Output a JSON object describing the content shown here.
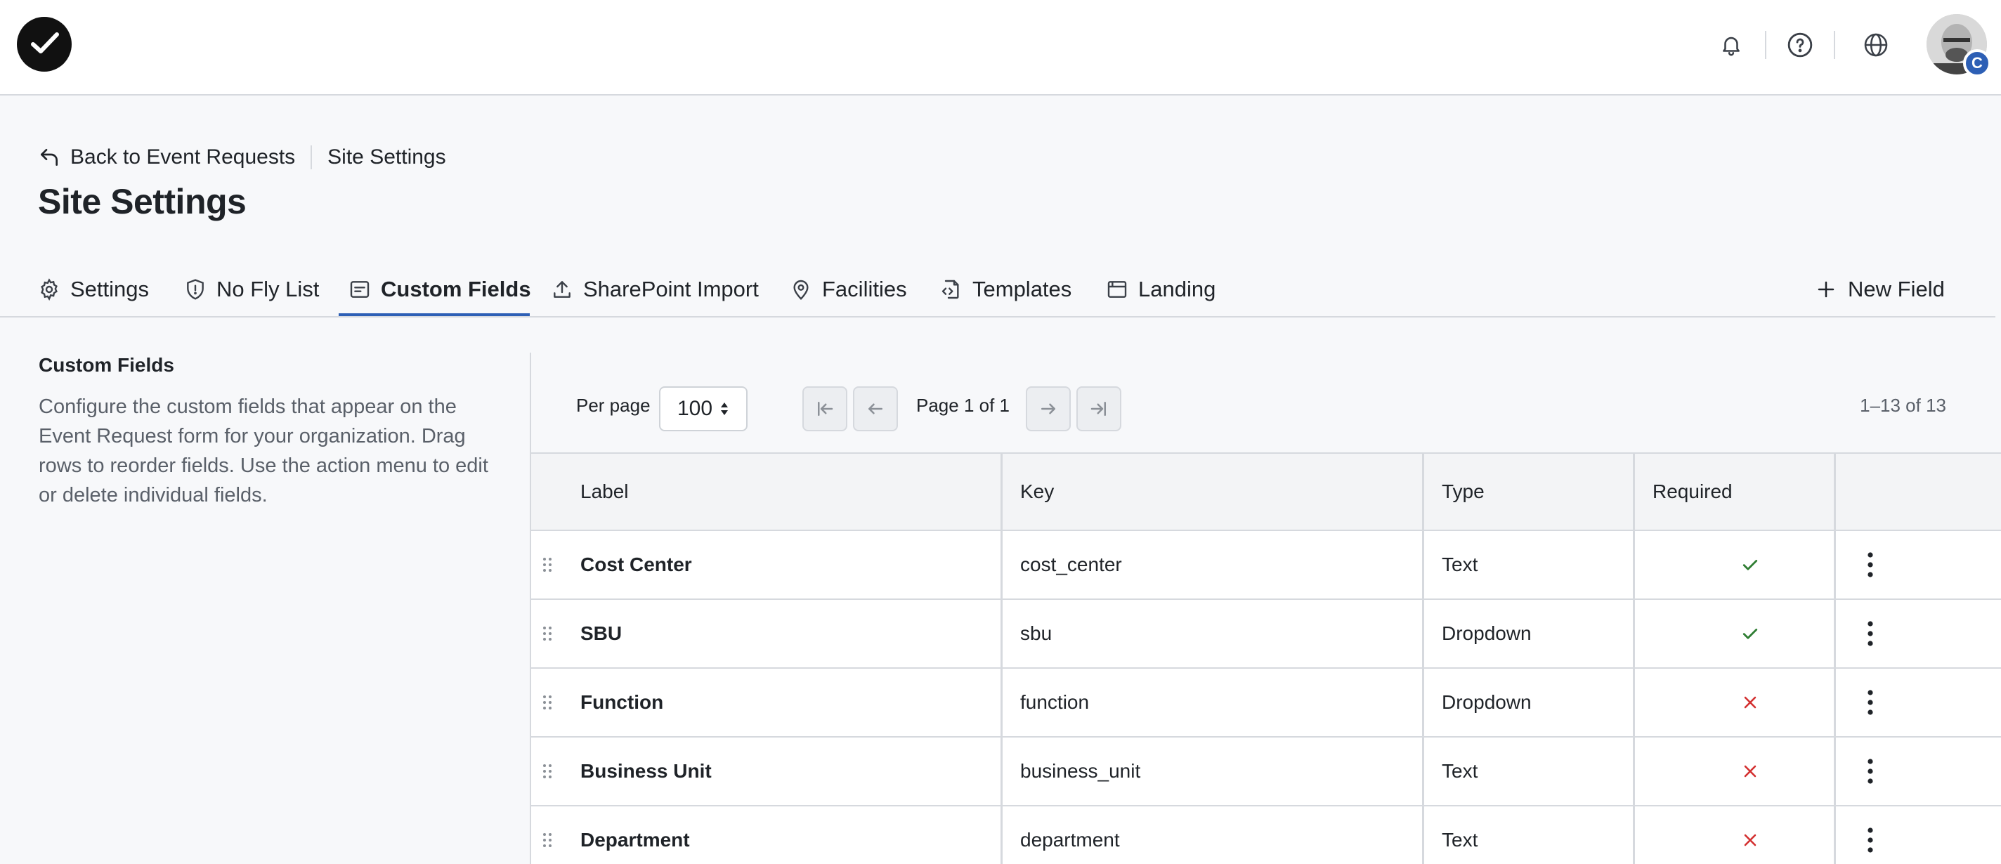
{
  "header": {
    "logo_icon": "check-logo-icon",
    "icons": [
      "bell-icon",
      "help-icon",
      "globe-icon"
    ],
    "avatar_badge": "C"
  },
  "breadcrumb": {
    "back_label": "Back to Event Requests",
    "current": "Site Settings"
  },
  "page_title": "Site Settings",
  "tabs": [
    {
      "label": "Settings",
      "icon": "gear-icon"
    },
    {
      "label": "No Fly List",
      "icon": "shield-icon"
    },
    {
      "label": "Custom Fields",
      "icon": "form-icon",
      "active": true
    },
    {
      "label": "SharePoint Import",
      "icon": "upload-icon"
    },
    {
      "label": "Facilities",
      "icon": "location-pin-icon"
    },
    {
      "label": "Templates",
      "icon": "code-file-icon"
    },
    {
      "label": "Landing",
      "icon": "browser-window-icon"
    }
  ],
  "new_field_label": "New Field",
  "sidebar": {
    "title": "Custom Fields",
    "description": "Configure the custom fields that appear on the Event Request form for your organization. Drag rows to reorder fields. Use the action menu to edit or delete individual fields."
  },
  "pager": {
    "per_page_label": "Per page",
    "per_page_value": "100",
    "page_text": "Page 1 of 1",
    "range_text": "1–13 of 13"
  },
  "table": {
    "headers": {
      "label": "Label",
      "key": "Key",
      "type": "Type",
      "required": "Required"
    },
    "rows": [
      {
        "label": "Cost Center",
        "key": "cost_center",
        "type": "Text",
        "required": true
      },
      {
        "label": "SBU",
        "key": "sbu",
        "type": "Dropdown",
        "required": true
      },
      {
        "label": "Function",
        "key": "function",
        "type": "Dropdown",
        "required": false
      },
      {
        "label": "Business Unit",
        "key": "business_unit",
        "type": "Text",
        "required": false
      },
      {
        "label": "Department",
        "key": "department",
        "type": "Text",
        "required": false
      }
    ]
  },
  "colors": {
    "accent": "#2d5fb5",
    "check": "#2e7d32",
    "cross": "#d32f2f"
  }
}
